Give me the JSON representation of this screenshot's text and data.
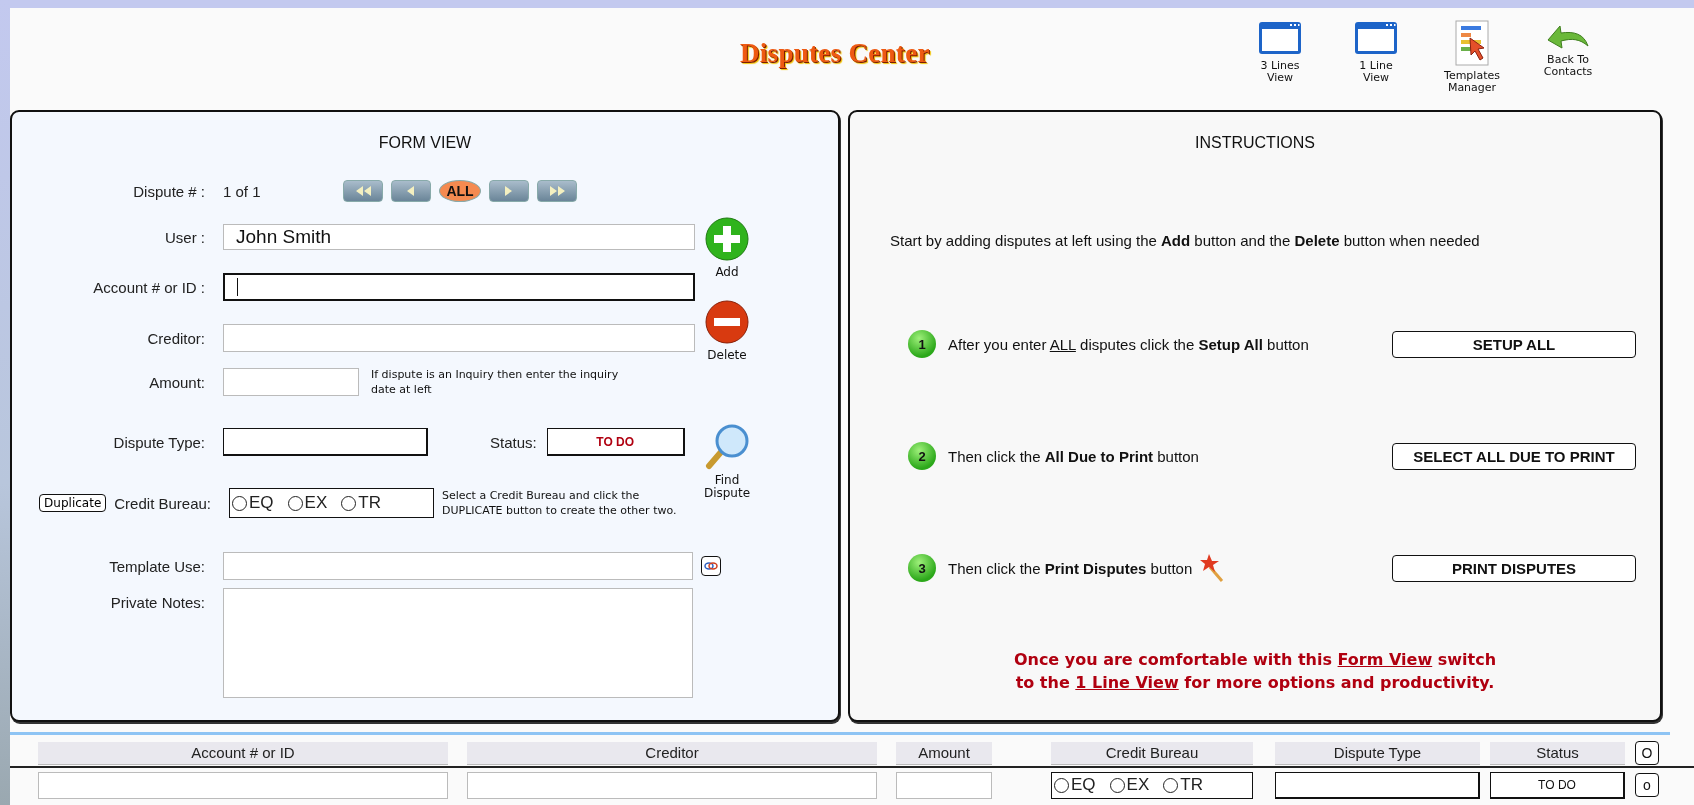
{
  "title": "Disputes Center",
  "toolbar": [
    {
      "kind": "window",
      "lines": [
        "3 Lines",
        "View"
      ]
    },
    {
      "kind": "window",
      "lines": [
        "1 Line",
        "View"
      ]
    },
    {
      "kind": "report",
      "lines": [
        "Templates",
        "Manager"
      ]
    },
    {
      "kind": "back",
      "lines": [
        "Back To",
        "Contacts"
      ]
    }
  ],
  "form": {
    "heading": "FORM VIEW",
    "dispute_label": "Dispute # :",
    "dispute_value": "1 of 1",
    "nav": [
      {
        "kind": "first"
      },
      {
        "kind": "prev"
      },
      {
        "kind": "all",
        "label": "ALL"
      },
      {
        "kind": "next"
      },
      {
        "kind": "last"
      }
    ],
    "user": {
      "label": "User :",
      "value": "John Smith"
    },
    "account": {
      "label": "Account # or ID :",
      "focused": true
    },
    "creditor": {
      "label": "Creditor:"
    },
    "amount": {
      "label": "Amount:",
      "note": "If dispute is an Inquiry then enter the inquiry date at left"
    },
    "dispute_type": {
      "label": "Dispute Type:"
    },
    "status": {
      "label": "Status:",
      "value": "TO DO"
    },
    "duplicate_button": "Duplicate",
    "credit_bureau": {
      "label": "Credit Bureau:",
      "options": [
        {
          "label": "EQ",
          "selected": false
        },
        {
          "label": "EX",
          "selected": false
        },
        {
          "label": "TR",
          "selected": false
        }
      ],
      "note": "Select a Credit Bureau and click the DUPLICATE button to create the other two."
    },
    "template": {
      "label": "Template Use:"
    },
    "notes": {
      "label": "Private Notes:"
    },
    "actions": [
      {
        "kind": "add",
        "label": "Add"
      },
      {
        "kind": "delete",
        "label": "Delete"
      },
      {
        "kind": "find",
        "label": "Find Dispute"
      }
    ]
  },
  "instructions": {
    "heading": "INSTRUCTIONS",
    "intro": "Start by adding disputes at left using the **Add**  button and the **Delete** button when needed",
    "steps": [
      {
        "number": "1",
        "segments": [
          {
            "kind": "plain",
            "text": "After you enter "
          },
          {
            "kind": "underline",
            "text": "ALL"
          },
          {
            "kind": "plain",
            "text": " disputes click the "
          },
          {
            "kind": "bold",
            "text": "Setup All"
          },
          {
            "kind": "plain",
            "text": "  button"
          }
        ],
        "button": "SETUP ALL",
        "wand": false
      },
      {
        "number": "2",
        "segments": [
          {
            "kind": "plain",
            "text": "Then click the "
          },
          {
            "kind": "bold",
            "text": "All Due to Print"
          },
          {
            "kind": "plain",
            "text": " button"
          }
        ],
        "button": "SELECT ALL DUE TO PRINT",
        "wand": false
      },
      {
        "number": "3",
        "segments": [
          {
            "kind": "plain",
            "text": "Then click the "
          },
          {
            "kind": "bold",
            "text": "Print Disputes"
          },
          {
            "kind": "plain",
            "text": " button"
          }
        ],
        "button": "PRINT DISPUTES",
        "wand": true
      }
    ],
    "footer": [
      [
        {
          "kind": "plain",
          "text": "Once you are comfortable with this "
        },
        {
          "kind": "underline",
          "text": "Form View"
        },
        {
          "kind": "plain",
          "text": " switch"
        }
      ],
      [
        {
          "kind": "plain",
          "text": "to the "
        },
        {
          "kind": "underline",
          "text": "1 Line View"
        },
        {
          "kind": "plain",
          "text": " for more options and productivity."
        }
      ]
    ]
  },
  "table": {
    "columns": [
      "Account # or ID",
      "Creditor",
      "Amount",
      "Credit Bureau",
      "Dispute Type",
      "Status",
      "O"
    ],
    "row": [
      {
        "kind": "text"
      },
      {
        "kind": "text"
      },
      {
        "kind": "text"
      },
      {
        "kind": "radios",
        "options": [
          {
            "label": "EQ",
            "selected": false
          },
          {
            "label": "EX",
            "selected": false
          },
          {
            "label": "TR",
            "selected": false
          }
        ]
      },
      {
        "kind": "select"
      },
      {
        "kind": "status",
        "value": "TO DO"
      },
      {
        "kind": "button",
        "label": "o"
      }
    ]
  }
}
